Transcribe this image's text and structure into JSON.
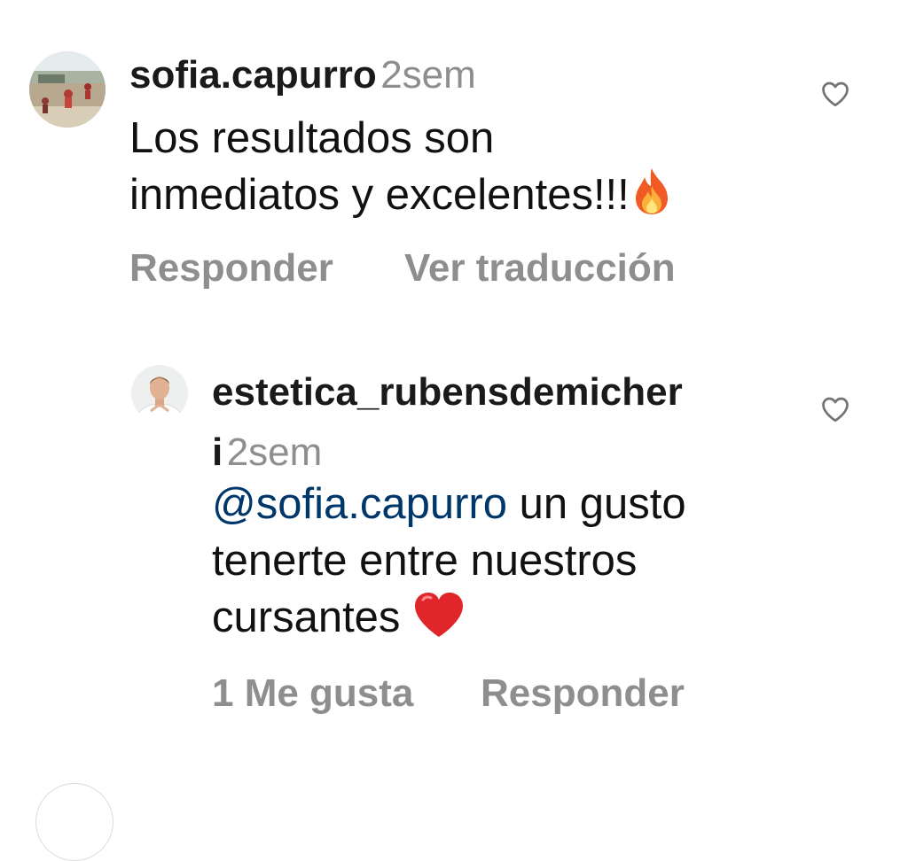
{
  "comments": [
    {
      "username": "sofia.capurro",
      "time": "2sem",
      "text_line1": "Los resultados son",
      "text_line2": "inmediatos y excelentes!!!",
      "emoji": "fire-emoji",
      "actions": {
        "reply": "Responder",
        "translate": "Ver traducción"
      },
      "avatar": "beach-photo-avatar"
    },
    {
      "username_line1": "estetica_rubensdemicher",
      "username_line2": "i",
      "time": "2sem",
      "mention": "@sofia.capurro",
      "text_line1_rest": " un gusto",
      "text_line2": "tenerte entre nuestros",
      "text_line3": "cursantes ",
      "emoji": "red-heart-emoji",
      "actions": {
        "likes": "1 Me gusta",
        "reply": "Responder"
      },
      "avatar": "man-portrait-avatar"
    }
  ],
  "colors": {
    "text": "#111111",
    "muted": "#8e8e8e",
    "mention": "#00376b"
  }
}
